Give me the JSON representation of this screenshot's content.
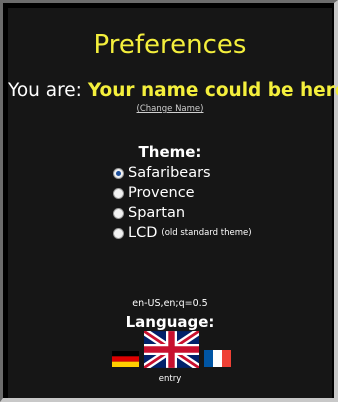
{
  "header": {
    "title": "Preferences",
    "you_are_label": "You are:",
    "user_name": "Your name could be here",
    "change_name_link": "(Change Name)"
  },
  "theme": {
    "heading": "Theme:",
    "options": [
      {
        "label": "Safaribears",
        "selected": true
      },
      {
        "label": "Provence",
        "selected": false
      },
      {
        "label": "Spartan",
        "selected": false
      },
      {
        "label": "LCD",
        "note": "(old standard theme)",
        "selected": false
      }
    ]
  },
  "language": {
    "accept_language": "en-US,en;q=0.5",
    "heading": "Language:",
    "flags": [
      "german-flag-icon",
      "uk-flag-icon",
      "french-flag-icon"
    ],
    "footer": "entry"
  },
  "colors": {
    "accent_yellow": "#f4ef3c",
    "panel_bg": "#161616",
    "text": "#ffffff"
  }
}
